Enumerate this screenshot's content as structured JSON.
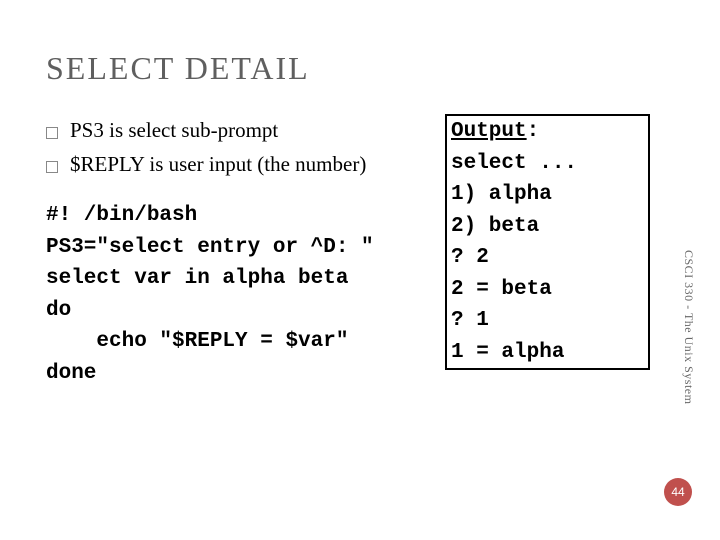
{
  "title": "SELECT DETAIL",
  "bullets": [
    "PS3 is select sub-prompt",
    "$REPLY is user input (the number)"
  ],
  "code": {
    "l1": "#! /bin/bash",
    "l2": "PS3=\"select entry or ^D: \"",
    "l3": "select var in alpha beta",
    "l4": "do",
    "l5": "    echo \"$REPLY = $var\"",
    "l6": "done"
  },
  "output": {
    "label": "Output",
    "colon": ":",
    "l1": "select ...",
    "l2": "1) alpha",
    "l3": "2) beta",
    "l4": "? 2",
    "l5": "2 = beta",
    "l6": "? 1",
    "l7": "1 = alpha"
  },
  "side": "CSCI 330 - The Unix System",
  "page": "44"
}
